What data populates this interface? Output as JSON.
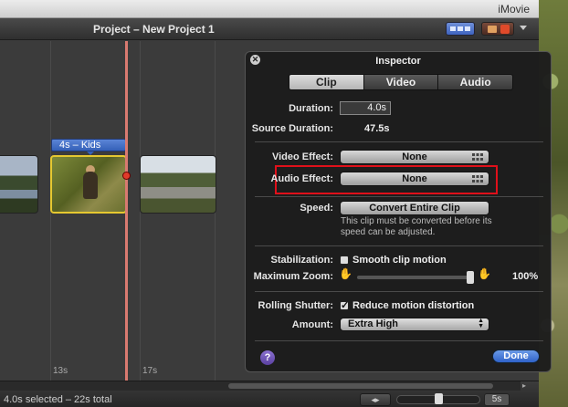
{
  "window": {
    "app_title": "iMovie"
  },
  "project": {
    "title": "Project – New Project 1"
  },
  "timeline": {
    "clip_label": "4s – Kids",
    "ticks": [
      "13s",
      "17s"
    ]
  },
  "status": {
    "selection": "4.0s selected – 22s total",
    "zoom_value": "5s"
  },
  "inspector": {
    "title": "Inspector",
    "tabs": [
      {
        "label": "Clip",
        "active": true
      },
      {
        "label": "Video",
        "active": false
      },
      {
        "label": "Audio",
        "active": false
      }
    ],
    "duration_label": "Duration:",
    "duration_value": "4.0s",
    "source_duration_label": "Source Duration:",
    "source_duration_value": "47.5s",
    "video_effect_label": "Video Effect:",
    "video_effect_value": "None",
    "audio_effect_label": "Audio Effect:",
    "audio_effect_value": "None",
    "speed_label": "Speed:",
    "speed_button": "Convert Entire Clip",
    "speed_note": "This clip must be converted before its speed can be adjusted.",
    "stabilization_label": "Stabilization:",
    "stabilization_option": "Smooth clip motion",
    "stabilization_checked": false,
    "max_zoom_label": "Maximum Zoom:",
    "max_zoom_value": "100%",
    "max_zoom_level": 1.0,
    "rolling_shutter_label": "Rolling Shutter:",
    "rolling_shutter_option": "Reduce motion distortion",
    "rolling_shutter_checked": true,
    "amount_label": "Amount:",
    "amount_value": "Extra High",
    "help_label": "?",
    "done_label": "Done"
  },
  "colors": {
    "highlight": "#e0101a",
    "accent": "#2f62c8",
    "selected_clip_border": "#e6c830",
    "playhead": "#d97a70"
  }
}
